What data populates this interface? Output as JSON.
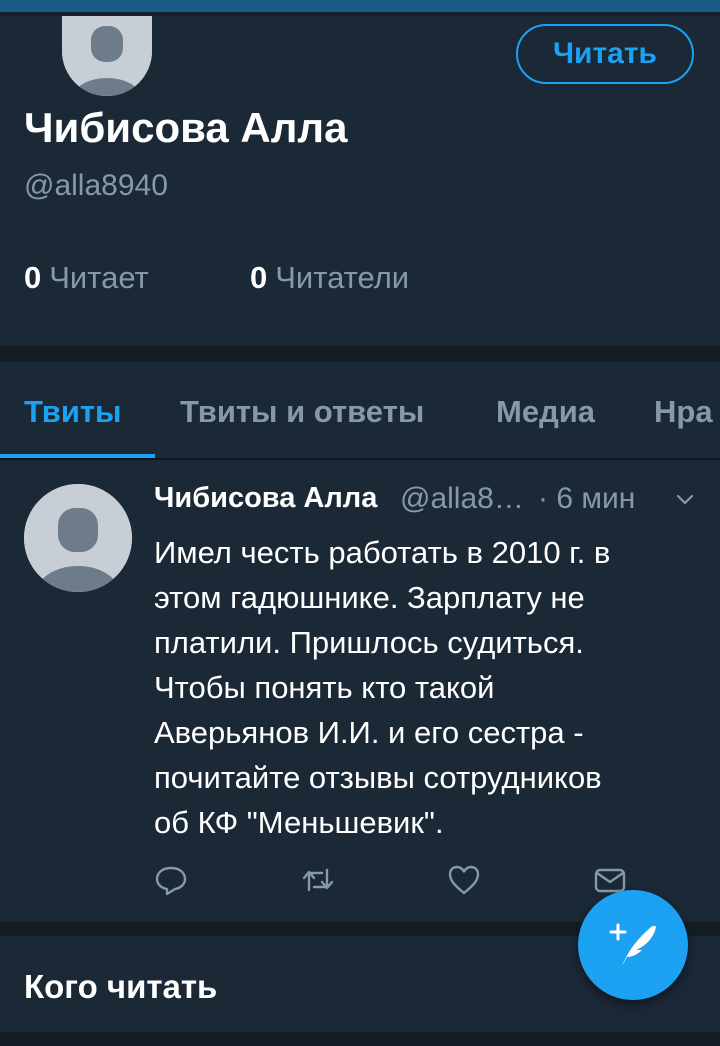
{
  "profile": {
    "name": "Чибисова Алла",
    "handle": "@alla8940",
    "follow_button_label": "Читать",
    "following_count": "0",
    "following_label": "Читает",
    "followers_count": "0",
    "followers_label": "Читатели"
  },
  "tabs": [
    {
      "label": "Твиты",
      "active": true
    },
    {
      "label": "Твиты и ответы",
      "active": false
    },
    {
      "label": "Медиа",
      "active": false
    },
    {
      "label": "Нра",
      "active": false
    }
  ],
  "tweet": {
    "author": "Чибисова Алла",
    "handle": "@alla8…",
    "time": "· 6 мин",
    "text": "Имел честь работать в 2010 г. в\nэтом гадюшнике. Зарплату не\nплатили. Пришлось судиться.\nЧтобы понять кто такой\nАверьянов И.И. и его сестра -\nпочитайте отзывы сотрудников\nоб КФ \"Меньшевик\".",
    "actions": {
      "reply_icon": "reply-icon",
      "retweet_icon": "retweet-icon",
      "like_icon": "heart-icon",
      "dm_icon": "envelope-icon"
    }
  },
  "who_to_follow": {
    "title": "Кого читать"
  },
  "fab": {
    "icon": "compose-tweet-icon"
  },
  "colors": {
    "accent": "#1da1f2",
    "background": "#141d26",
    "card": "#1b2836",
    "secondary_text": "#8899a6"
  }
}
